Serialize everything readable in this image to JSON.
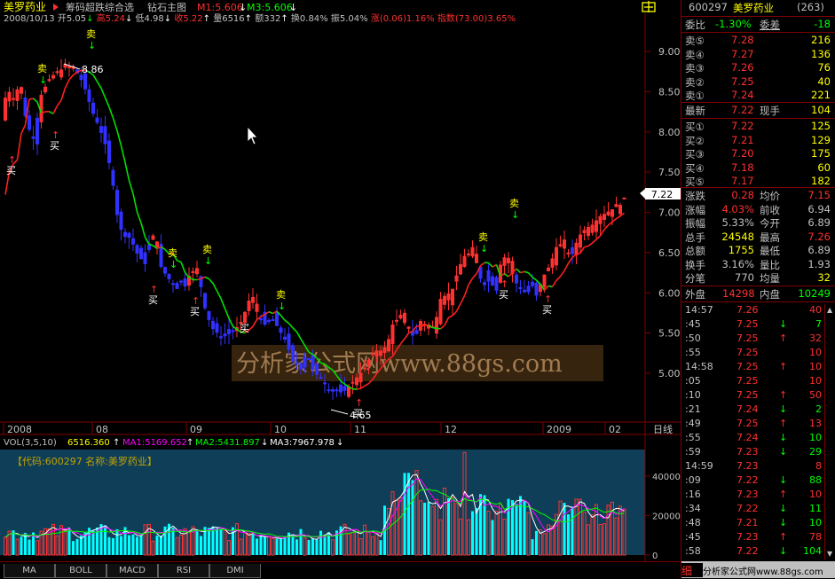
{
  "header": {
    "stock_name": "美罗药业",
    "formula_name": "筹码超跌综合选",
    "chart_name": "钻石主图",
    "m1": "M1:5.606",
    "m3": "M3:5.606",
    "corner_icon": "lock-icon"
  },
  "info_line": {
    "date": "2008/10/13",
    "open": "开5.05",
    "high": "高5.24",
    "low": "低4.98",
    "close": "收5.22",
    "volume": "量6516",
    "amount": "额332",
    "turnover": "换0.84%",
    "amplitude": "振5.04%",
    "change": "涨(0.06)1.16%",
    "index": "指数(73.00)3.65%"
  },
  "price_axis": {
    "labels": [
      "9.00",
      "8.50",
      "8.00",
      "7.50",
      "7.00",
      "6.50",
      "6.00",
      "5.50",
      "5.00"
    ],
    "current_label": "7.22"
  },
  "date_axis": {
    "labels": [
      "2008",
      "08",
      "09",
      "10",
      "11",
      "12",
      "2009",
      "02"
    ],
    "period_label": "日线"
  },
  "annotations": {
    "high_mark": "8.86",
    "low_mark": "4.65",
    "sell": "卖",
    "buy": "买"
  },
  "watermark": "分析家公式网www.88gs.com",
  "volume_panel": {
    "legend": {
      "vol": "VOL(3,5,10)",
      "vol_value": "6516.360",
      "ma1": "MA1:5169.652",
      "ma2": "MA2:5431.897",
      "ma3": "MA3:7967.978"
    },
    "code_label": "【代码:600297 名称:美罗药业】",
    "axis_labels": [
      "40000",
      "20000",
      "0"
    ]
  },
  "bottom_tabs": [
    "MA",
    "BOLL",
    "MACD",
    "RSI",
    "DMI"
  ],
  "quote": {
    "code": "600297",
    "name": "美罗药业",
    "rank": "(263)",
    "weibi_label": "委比",
    "weibi_value": "-1.30%",
    "weicha_label": "委差",
    "weicha_value": "-18",
    "sell": [
      {
        "label": "卖⑤",
        "price": "7.28",
        "vol": "216"
      },
      {
        "label": "卖④",
        "price": "7.27",
        "vol": "136"
      },
      {
        "label": "卖③",
        "price": "7.26",
        "vol": "76"
      },
      {
        "label": "卖②",
        "price": "7.25",
        "vol": "40"
      },
      {
        "label": "卖①",
        "price": "7.24",
        "vol": "221"
      }
    ],
    "latest_label": "最新",
    "latest_value": "7.22",
    "current_hand_label": "现手",
    "current_hand_value": "104",
    "buy": [
      {
        "label": "买①",
        "price": "7.22",
        "vol": "125"
      },
      {
        "label": "买②",
        "price": "7.21",
        "vol": "129"
      },
      {
        "label": "买③",
        "price": "7.20",
        "vol": "175"
      },
      {
        "label": "买④",
        "price": "7.18",
        "vol": "60"
      },
      {
        "label": "买⑤",
        "price": "7.17",
        "vol": "182"
      }
    ],
    "stats": [
      {
        "l1": "涨跌",
        "v1": "0.28",
        "l2": "均价",
        "v2": "7.15"
      },
      {
        "l1": "涨幅",
        "v1": "4.03%",
        "l2": "前收",
        "v2": "6.94"
      },
      {
        "l1": "振幅",
        "v1": "5.33%",
        "l2": "今开",
        "v2": "6.89"
      },
      {
        "l1": "总手",
        "v1": "24548",
        "l2": "最高",
        "v2": "7.26"
      },
      {
        "l1": "总额",
        "v1": "1755",
        "l2": "最低",
        "v2": "6.89"
      },
      {
        "l1": "换手",
        "v1": "3.16%",
        "l2": "量比",
        "v2": "1.93"
      },
      {
        "l1": "分笔",
        "v1": "770",
        "l2": "均量",
        "v2": "32"
      }
    ],
    "outer_label": "外盘",
    "outer_value": "14298",
    "inner_label": "内盘",
    "inner_value": "10249"
  },
  "ticks": [
    {
      "time": "14:57",
      "price": "7.26",
      "dir": "",
      "vol": "40"
    },
    {
      "time": ":45",
      "price": "7.25",
      "dir": "↓",
      "vol": "7"
    },
    {
      "time": ":50",
      "price": "7.25",
      "dir": "↑",
      "vol": "32"
    },
    {
      "time": ":55",
      "price": "7.25",
      "dir": "",
      "vol": "10"
    },
    {
      "time": "14:58",
      "price": "7.25",
      "dir": "↑",
      "vol": "10"
    },
    {
      "time": ":05",
      "price": "7.25",
      "dir": "",
      "vol": "10"
    },
    {
      "time": ":10",
      "price": "7.25",
      "dir": "↑",
      "vol": "50"
    },
    {
      "time": ":21",
      "price": "7.24",
      "dir": "↓",
      "vol": "2"
    },
    {
      "time": ":49",
      "price": "7.25",
      "dir": "↑",
      "vol": "13"
    },
    {
      "time": ":55",
      "price": "7.24",
      "dir": "↓",
      "vol": "10"
    },
    {
      "time": ":59",
      "price": "7.23",
      "dir": "↓",
      "vol": "29"
    },
    {
      "time": "14:59",
      "price": "7.23",
      "dir": "",
      "vol": "8"
    },
    {
      "time": ":09",
      "price": "7.22",
      "dir": "↓",
      "vol": "88"
    },
    {
      "time": ":16",
      "price": "7.23",
      "dir": "↑",
      "vol": "10"
    },
    {
      "time": ":34",
      "price": "7.22",
      "dir": "↓",
      "vol": "11"
    },
    {
      "time": ":48",
      "price": "7.21",
      "dir": "↓",
      "vol": "10"
    },
    {
      "time": ":45",
      "price": "7.23",
      "dir": "↑",
      "vol": "78"
    },
    {
      "time": ":58",
      "price": "7.22",
      "dir": "↓",
      "vol": "104"
    }
  ],
  "footer": {
    "detail_label": "细",
    "site": "分析家公式网www.88gs.com"
  },
  "colors": {
    "up": "#ff3030",
    "down": "#3030ff",
    "axis": "#800000",
    "ma_green": "#00e000",
    "ma_red": "#ff2020",
    "yellow": "#ffff00",
    "cyan": "#00ffff"
  }
}
